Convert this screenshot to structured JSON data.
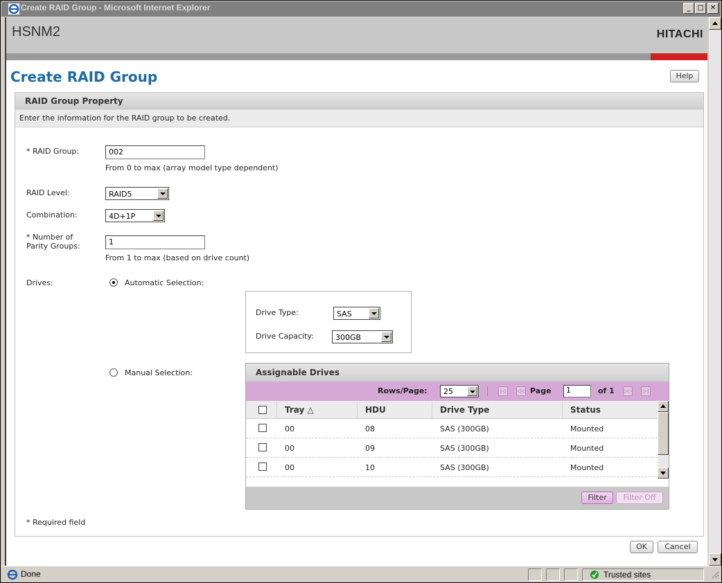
{
  "window": {
    "title": "Create RAID Group - Microsoft Internet Explorer",
    "min": "_",
    "max": "□",
    "close": "✕"
  },
  "banner": {
    "app_name": "HSNM2",
    "brand": "HITACHI"
  },
  "page": {
    "title": "Create RAID Group",
    "help_label": "Help"
  },
  "panel": {
    "heading": "RAID Group Property",
    "description": "Enter the information for the RAID group to be created."
  },
  "form": {
    "raid_group": {
      "label": "* RAID Group:",
      "value": "002",
      "hint": "From 0 to max (array model type dependent)"
    },
    "raid_level": {
      "label": "RAID Level:",
      "value": "RAID5"
    },
    "combination": {
      "label": "Combination:",
      "value": "4D+1P"
    },
    "parity_groups": {
      "label_line1": "* Number of",
      "label_line2": "Parity Groups:",
      "value": "1",
      "hint": "From 1 to max (based on drive count)"
    },
    "drives": {
      "label": "Drives:",
      "automatic_label": "Automatic Selection:",
      "automatic_selected": true,
      "manual_label": "Manual Selection:",
      "drive_type_label": "Drive Type:",
      "drive_type_value": "SAS",
      "drive_capacity_label": "Drive Capacity:",
      "drive_capacity_value": "300GB"
    },
    "required_note": "* Required field"
  },
  "assignable": {
    "heading": "Assignable Drives",
    "rows_per_page_label": "Rows/Page:",
    "rows_per_page_value": "25",
    "page_label": "Page",
    "page_value": "1",
    "of_label": "of 1",
    "columns": [
      "Tray",
      "HDU",
      "Drive Type",
      "Status"
    ],
    "sort_indicator": "△",
    "rows": [
      {
        "tray": "00",
        "hdu": "08",
        "drive_type": "SAS (300GB)",
        "status": "Mounted"
      },
      {
        "tray": "00",
        "hdu": "09",
        "drive_type": "SAS (300GB)",
        "status": "Mounted"
      },
      {
        "tray": "00",
        "hdu": "10",
        "drive_type": "SAS (300GB)",
        "status": "Mounted"
      }
    ],
    "filter_label": "Filter",
    "filter_off_label": "Filter Off"
  },
  "actions": {
    "ok_label": "OK",
    "cancel_label": "Cancel"
  },
  "status": {
    "text": "Done",
    "zone": "Trusted sites"
  }
}
